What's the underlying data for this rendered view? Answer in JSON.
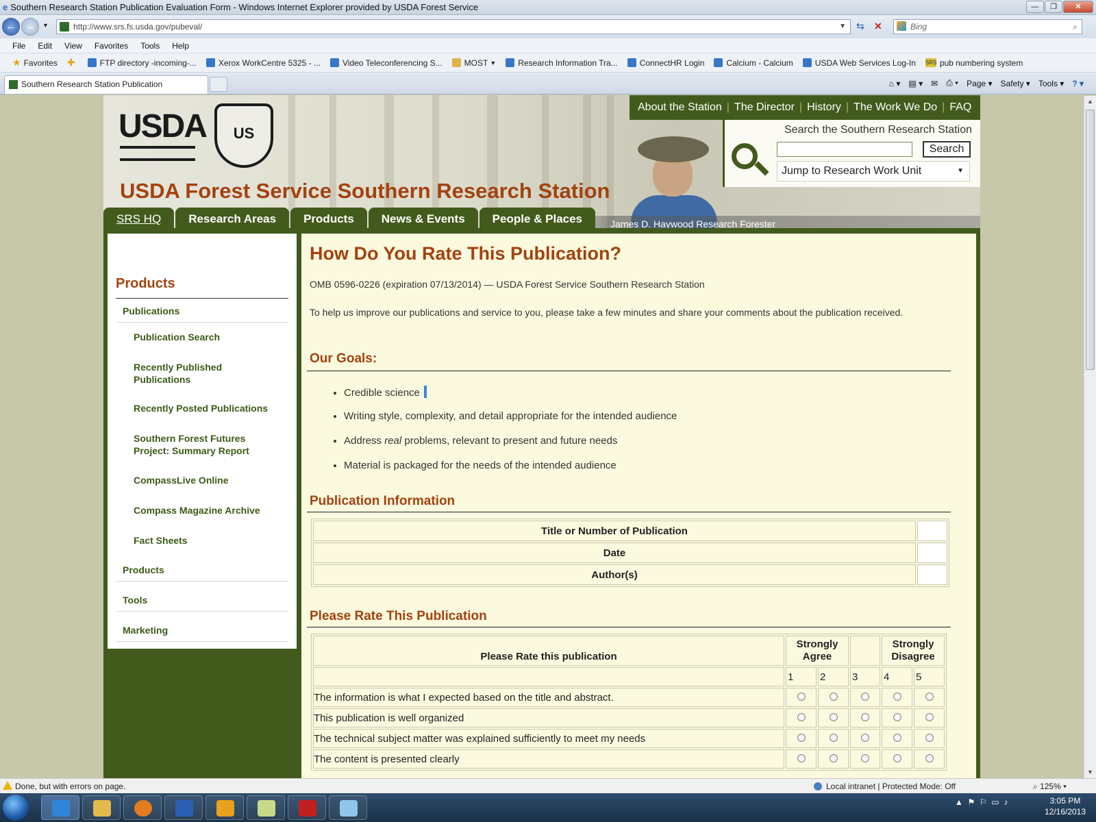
{
  "window": {
    "title": "Southern Research Station Publication Evaluation Form - Windows Internet Explorer provided by USDA Forest Service"
  },
  "browser": {
    "url": "http://www.srs.fs.usda.gov/pubeval/",
    "search_placeholder": "Bing",
    "menu": [
      "File",
      "Edit",
      "View",
      "Favorites",
      "Tools",
      "Help"
    ],
    "favorites_label": "Favorites",
    "favorites": [
      "FTP directory -incoming-...",
      "Xerox WorkCentre 5325 - ...",
      "Video Teleconferencing S...",
      "MOST",
      "Research Information Tra...",
      "ConnectHR Login",
      "Calcium - Calcium",
      "USDA Web Services Log-In",
      "pub numbering system"
    ],
    "srs_badge": "SRS",
    "tab_title": "Southern Research Station Publication Evaluation...",
    "command_bar": [
      "Page ▾",
      "Safety ▾",
      "Tools ▾"
    ],
    "status": "Done, but with errors on page.",
    "zone": "Local intranet | Protected Mode: Off",
    "zoom": "125%",
    "clock_time": "3:05 PM",
    "clock_date": "12/16/2013"
  },
  "site": {
    "usda_logo": "USDA",
    "fs_shield": "US",
    "title": "USDA Forest Service Southern Research Station",
    "top_nav": [
      "About the Station",
      "The Director",
      "History",
      "The Work We Do",
      "FAQ"
    ],
    "search_label": "Search the Southern Research Station",
    "search_button": "Search",
    "jump_label": "Jump to Research Work Unit",
    "photo_caption": "James D. Haywood  Research Forester",
    "main_nav": [
      "SRS HQ",
      "Research Areas",
      "Products",
      "News & Events",
      "People & Places"
    ]
  },
  "sidebar": {
    "heading": "Products",
    "items": [
      {
        "label": "Publications",
        "level": "top"
      },
      {
        "label": "Publication Search",
        "level": "sub"
      },
      {
        "label": "Recently Published Publications",
        "level": "sub"
      },
      {
        "label": "Recently Posted Publications",
        "level": "sub"
      },
      {
        "label": "Southern Forest Futures Project: Summary Report",
        "level": "sub"
      },
      {
        "label": "CompassLive Online",
        "level": "sub"
      },
      {
        "label": "Compass Magazine Archive",
        "level": "sub"
      },
      {
        "label": "Fact Sheets",
        "level": "sub"
      },
      {
        "label": "Products",
        "level": "top"
      },
      {
        "label": "Tools",
        "level": "top"
      },
      {
        "label": "Marketing",
        "level": "top"
      }
    ]
  },
  "main": {
    "heading": "How Do You Rate This Publication?",
    "omb": "OMB 0596-0226 (expiration 07/13/2014) — USDA Forest Service Southern Research Station",
    "intro": "To help us improve our publications and service to you, please take a few minutes and share your comments about the publication received.",
    "goals_heading": "Our Goals:",
    "goals": [
      {
        "pre": "Credible science",
        "em": "",
        "post": ""
      },
      {
        "pre": "Writing style, complexity, and detail appropriate for the intended audience",
        "em": "",
        "post": ""
      },
      {
        "pre": "Address ",
        "em": "real",
        "post": " problems, relevant to present and future needs"
      },
      {
        "pre": "Material is packaged for the needs of the intended audience",
        "em": "",
        "post": ""
      }
    ],
    "pubinfo_heading": "Publication Information",
    "pubinfo_fields": [
      "Title or Number of Publication",
      "Date",
      "Author(s)"
    ],
    "rate_heading": "Please Rate This Publication",
    "rate_table": {
      "header": "Please Rate this publication",
      "strongly_agree": "Strongly Agree",
      "strongly_disagree": "Strongly Disagree",
      "scale": [
        "1",
        "2",
        "3",
        "4",
        "5"
      ],
      "rows": [
        "The information is what I expected based on the title and abstract.",
        "This publication is well organized",
        "The technical subject matter was explained sufficiently to meet my needs",
        "The content is presented clearly"
      ]
    }
  }
}
